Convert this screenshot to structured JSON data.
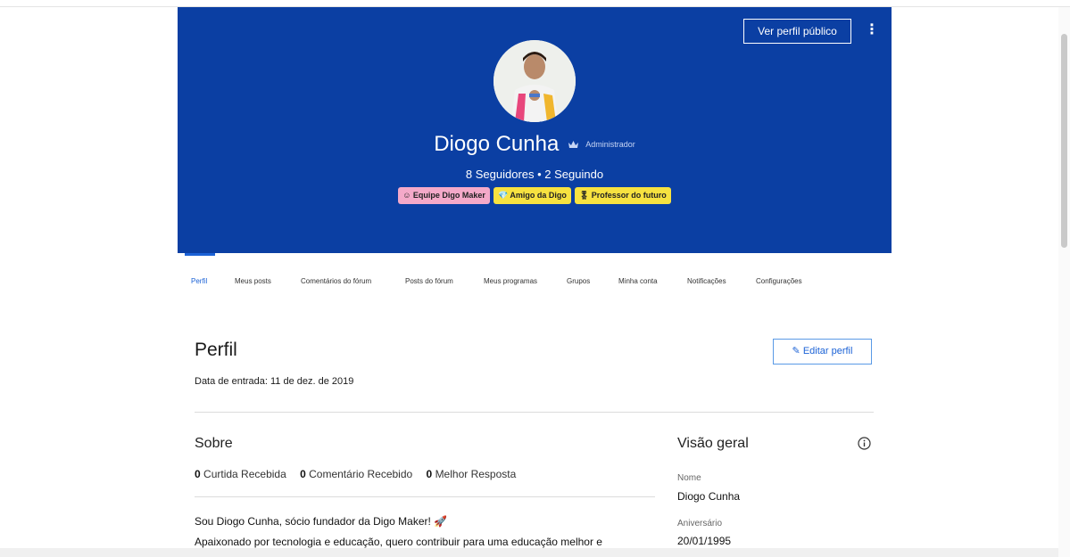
{
  "header": {
    "public_profile_button": "Ver perfil público",
    "more_menu_glyph": "⋮",
    "name": "Diogo Cunha",
    "role": "Administrador",
    "role_icon": "crown-icon",
    "followers": "8 Seguidores • 2 Seguindo",
    "badges": [
      {
        "label": "Equipe Digo Maker",
        "icon": "smiley-icon",
        "color": "#f4a9c9"
      },
      {
        "label": "Amigo da Digo",
        "icon": "diamond-icon",
        "color": "#f7e240"
      },
      {
        "label": "Professor do futuro",
        "icon": "medal-icon",
        "color": "#f7e240"
      }
    ],
    "background_color": "#0b3fa3"
  },
  "tabs": [
    {
      "label": "Perfil",
      "active": true
    },
    {
      "label": "Meus posts"
    },
    {
      "label": "Comentários do fórum"
    },
    {
      "label": "Posts do fórum"
    },
    {
      "label": "Meus programas"
    },
    {
      "label": "Grupos"
    },
    {
      "label": "Minha conta"
    },
    {
      "label": "Notificações"
    },
    {
      "label": "Configurações"
    }
  ],
  "profile": {
    "title": "Perfil",
    "edit_button": "Editar perfil",
    "joined": "Data de entrada: 11 de dez. de 2019"
  },
  "about": {
    "title": "Sobre",
    "stats": [
      {
        "count": "0",
        "label": "Curtida Recebida"
      },
      {
        "count": "0",
        "label": "Comentário Recebido"
      },
      {
        "count": "0",
        "label": "Melhor Resposta"
      }
    ],
    "bio_line1": "Sou Diogo Cunha, sócio fundador da Digo Maker! 🚀",
    "bio_line2": "Apaixonado por tecnologia e educação, quero contribuir para uma educação melhor e"
  },
  "overview": {
    "title": "Visão geral",
    "name_label": "Nome",
    "name_value": "Diogo Cunha",
    "birthday_label": "Aniversário",
    "birthday_value": "20/01/1995"
  },
  "accent_color": "#1b62d6"
}
